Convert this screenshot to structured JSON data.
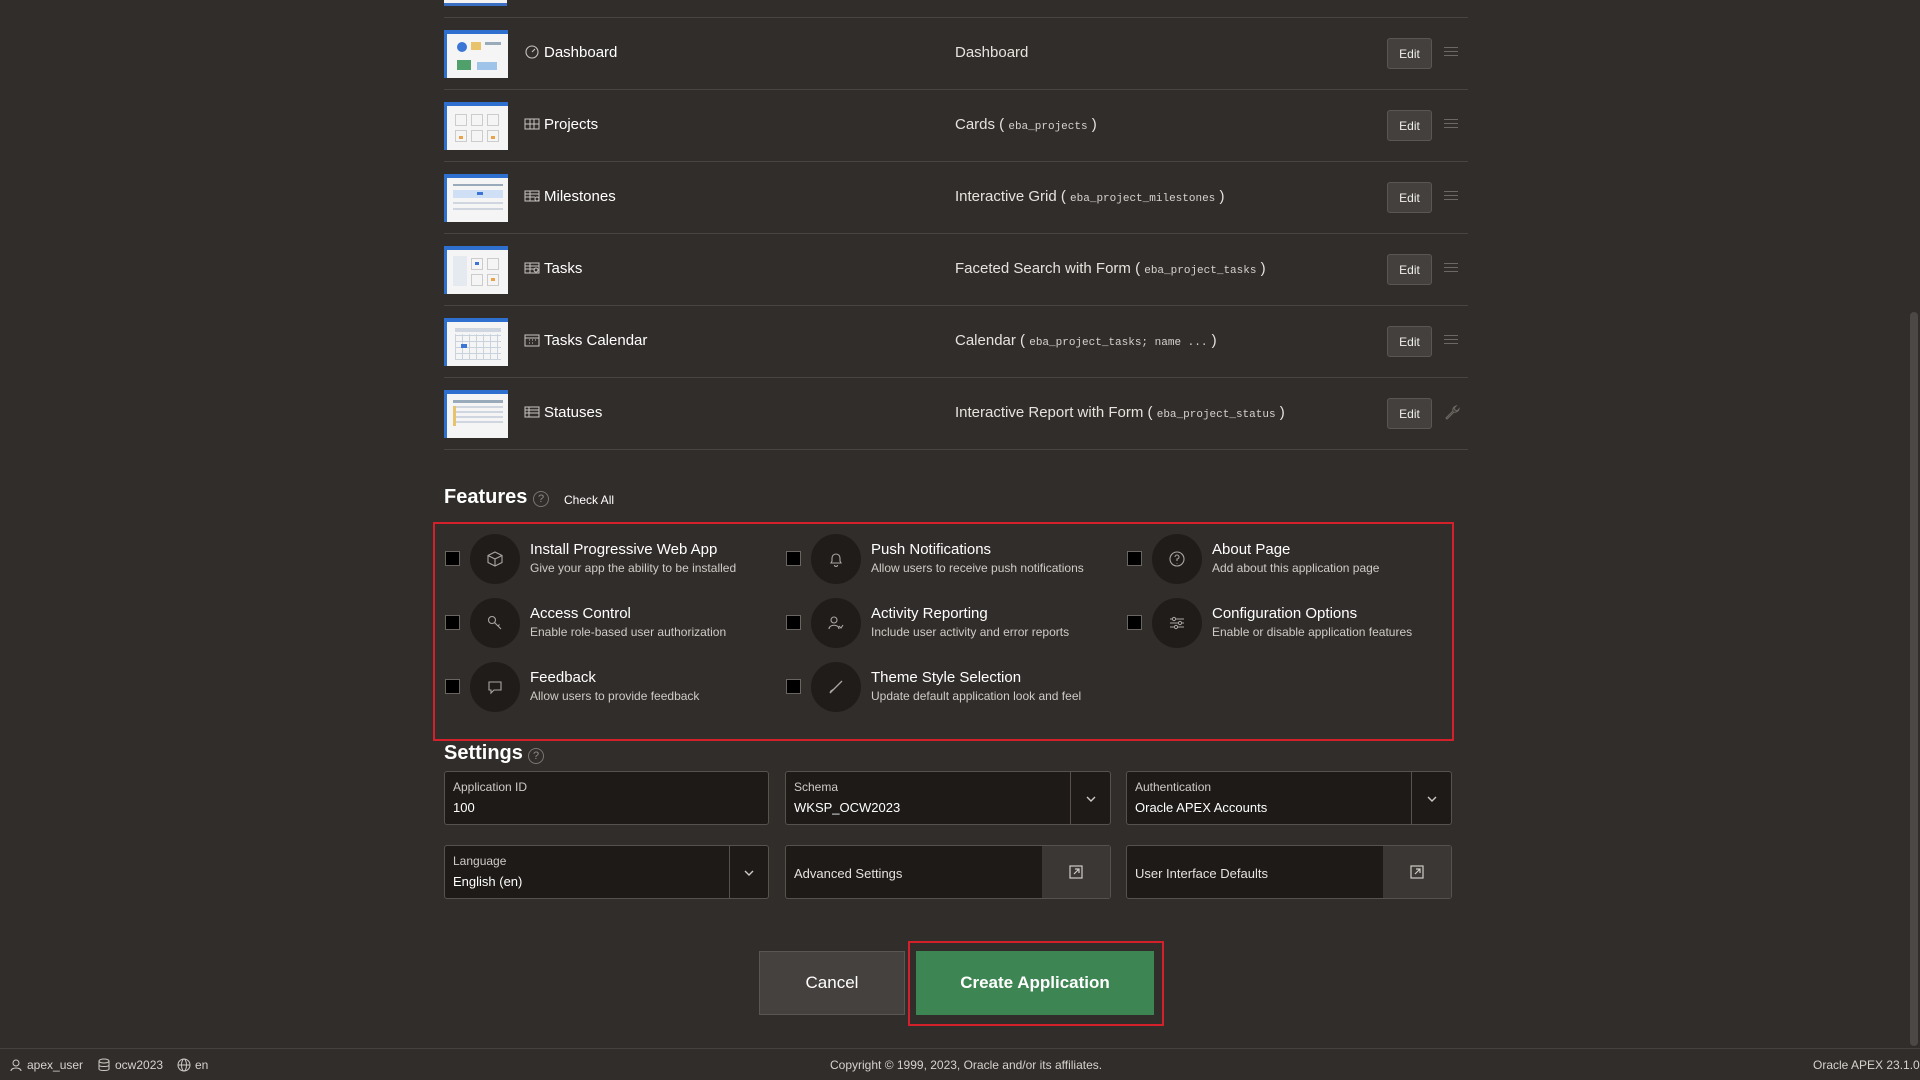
{
  "pages": [
    {
      "name": "Dashboard",
      "icon": "dashboard-icon",
      "type_label": "Dashboard",
      "table": "",
      "after": "",
      "action": "Edit",
      "trailing_icon": "drag-handle-icon"
    },
    {
      "name": "Projects",
      "icon": "cards-icon",
      "type_label": "Cards (",
      "table": "eba_projects",
      "after": ")",
      "action": "Edit",
      "trailing_icon": "drag-handle-icon"
    },
    {
      "name": "Milestones",
      "icon": "grid-icon",
      "type_label": "Interactive Grid (",
      "table": "eba_project_milestones",
      "after": ")",
      "action": "Edit",
      "trailing_icon": "drag-handle-icon"
    },
    {
      "name": "Tasks",
      "icon": "search-grid-icon",
      "type_label": "Faceted Search with Form (",
      "table": "eba_project_tasks",
      "after": ")",
      "action": "Edit",
      "trailing_icon": "drag-handle-icon"
    },
    {
      "name": "Tasks Calendar",
      "icon": "calendar-icon",
      "type_label": "Calendar (",
      "table": "eba_project_tasks; name ...",
      "after": ")",
      "action": "Edit",
      "trailing_icon": "drag-handle-icon"
    },
    {
      "name": "Statuses",
      "icon": "report-icon",
      "type_label": "Interactive Report with Form (",
      "table": "eba_project_status",
      "after": ")",
      "action": "Edit",
      "trailing_icon": "wrench-icon"
    }
  ],
  "features": {
    "title": "Features",
    "check_all": "Check All",
    "items": [
      {
        "title": "Install Progressive Web App",
        "desc": "Give your app the ability to be installed",
        "icon": "box-icon"
      },
      {
        "title": "Push Notifications",
        "desc": "Allow users to receive push notifications",
        "icon": "bell-icon"
      },
      {
        "title": "About Page",
        "desc": "Add about this application page",
        "icon": "question-icon"
      },
      {
        "title": "Access Control",
        "desc": "Enable role-based user authorization",
        "icon": "key-icon"
      },
      {
        "title": "Activity Reporting",
        "desc": "Include user activity and error reports",
        "icon": "user-activity-icon"
      },
      {
        "title": "Configuration Options",
        "desc": "Enable or disable application features",
        "icon": "sliders-icon"
      },
      {
        "title": "Feedback",
        "desc": "Allow users to provide feedback",
        "icon": "comment-icon"
      },
      {
        "title": "Theme Style Selection",
        "desc": "Update default application look and feel",
        "icon": "brush-icon"
      }
    ]
  },
  "settings": {
    "title": "Settings",
    "app_id": {
      "label": "Application ID",
      "value": "100"
    },
    "schema": {
      "label": "Schema",
      "value": "WKSP_OCW2023"
    },
    "authentication": {
      "label": "Authentication",
      "value": "Oracle APEX Accounts"
    },
    "language": {
      "label": "Language",
      "value": "English (en)"
    },
    "advanced": {
      "label": "Advanced Settings"
    },
    "ui_defaults": {
      "label": "User Interface Defaults"
    }
  },
  "buttons": {
    "cancel": "Cancel",
    "create": "Create Application"
  },
  "footer": {
    "user": "apex_user",
    "workspace": "ocw2023",
    "language": "en",
    "copyright": "Copyright © 1999, 2023, Oracle and/or its affiliates.",
    "version": "Oracle APEX 23.1.0"
  },
  "colors": {
    "primary": "#3e8554",
    "highlight": "#d4202a",
    "background": "#312d2a"
  }
}
